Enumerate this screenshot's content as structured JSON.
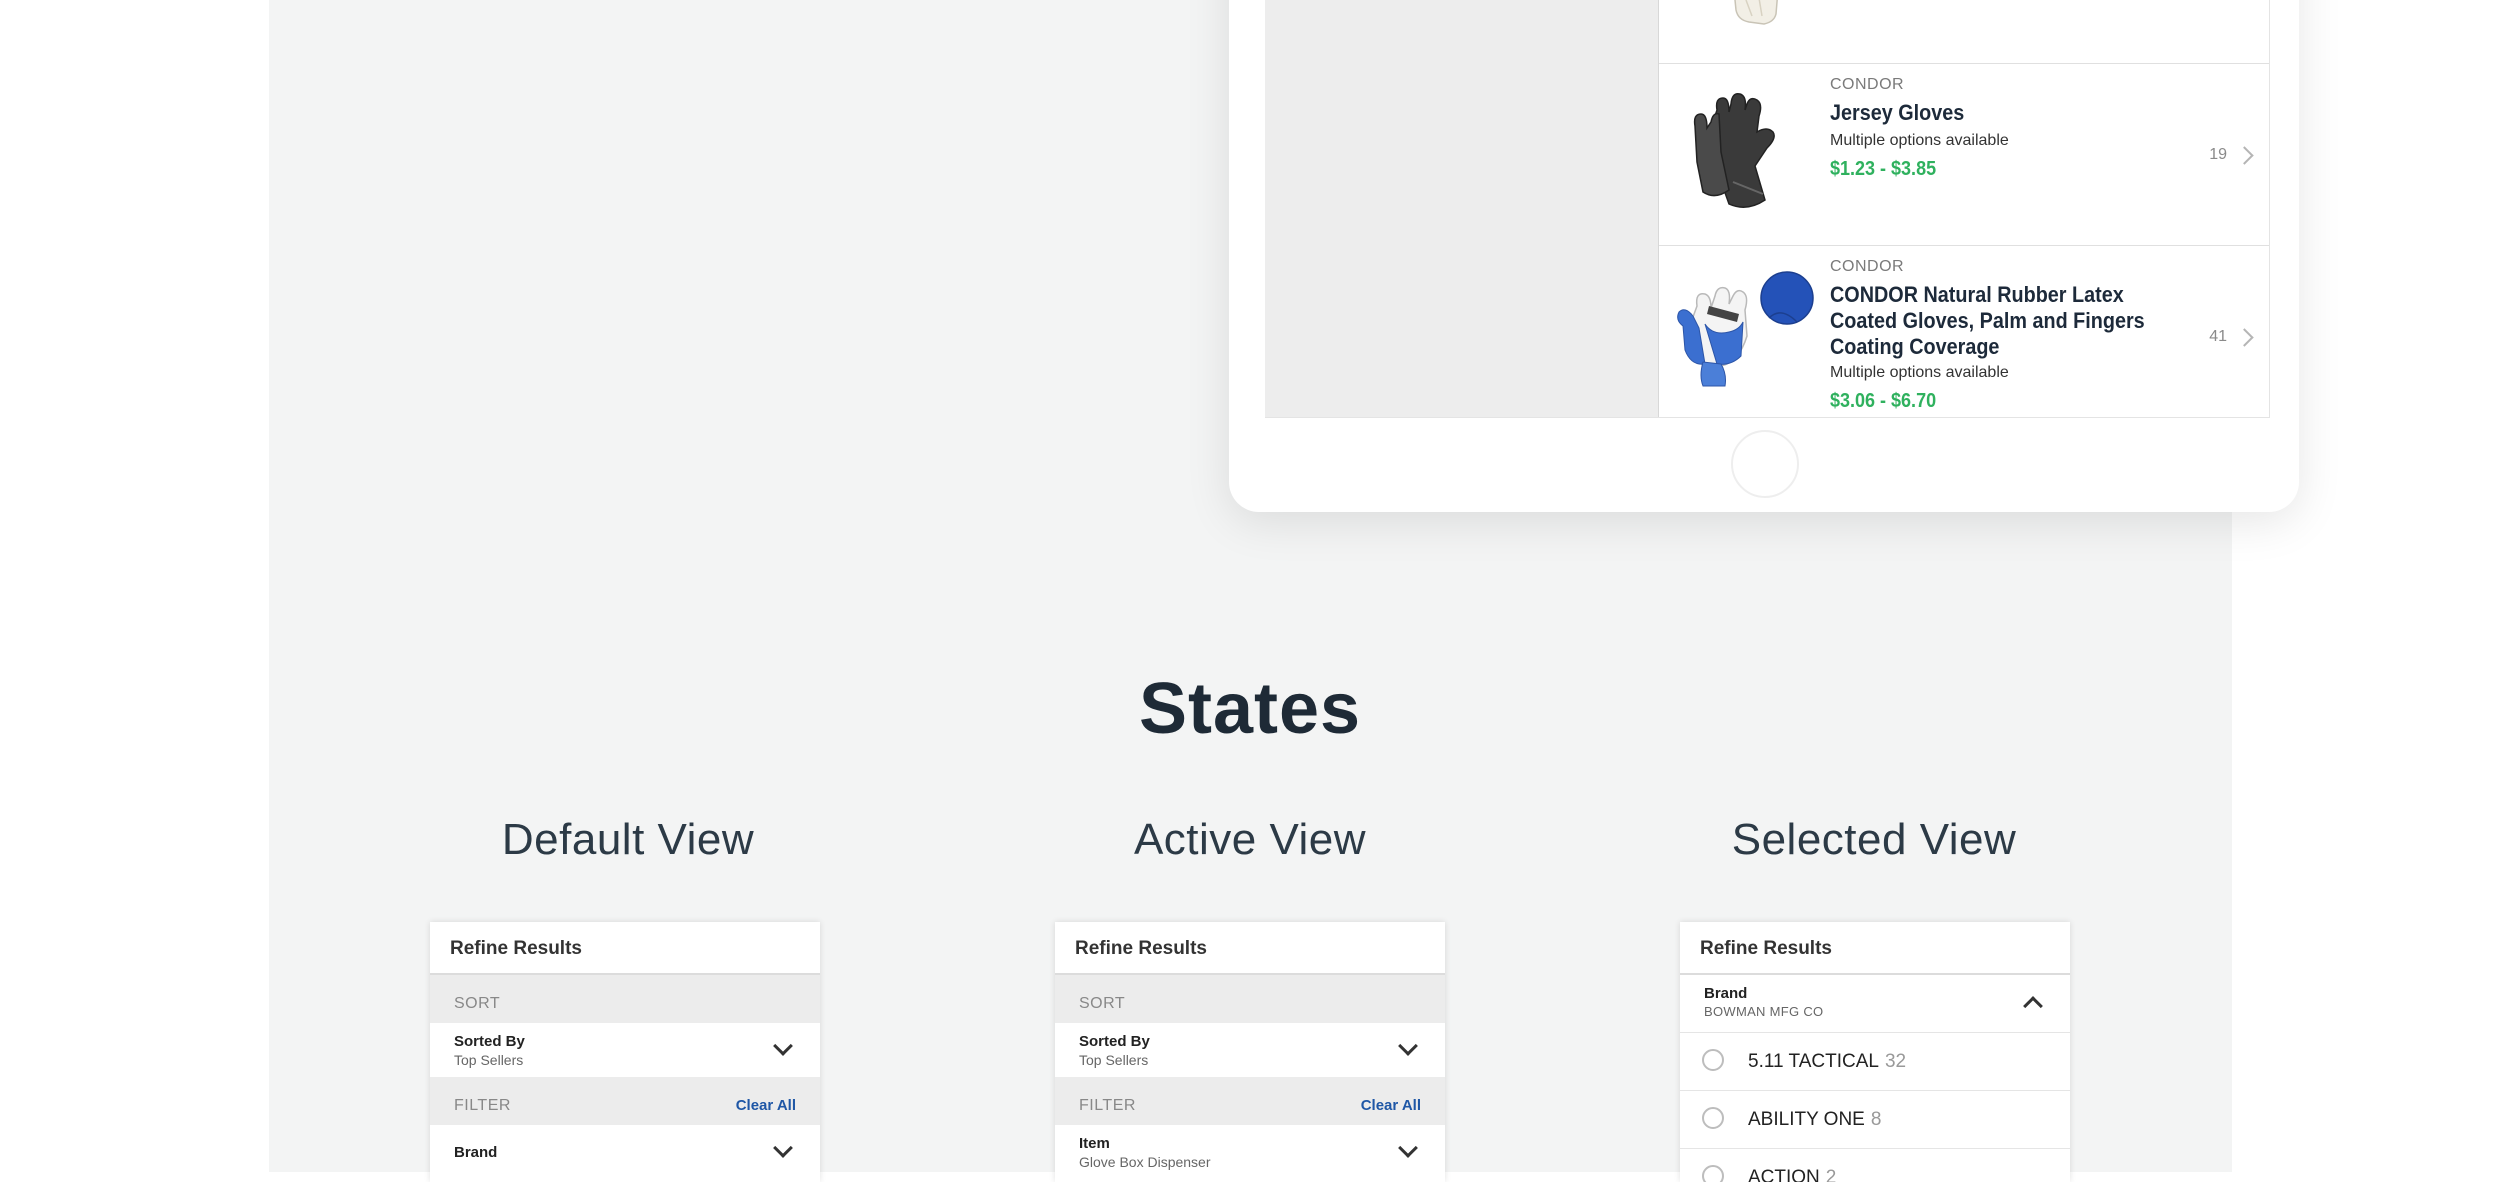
{
  "products": [
    {
      "brand": "",
      "name": "",
      "options": "",
      "price": "",
      "count": ""
    },
    {
      "brand": "CONDOR",
      "name": "Jersey Gloves",
      "options": "Multiple options available",
      "price": "$1.23 - $3.85",
      "count": "19"
    },
    {
      "brand": "CONDOR",
      "name": "CONDOR Natural Rubber Latex Coated Gloves, Palm and Fingers Coating Coverage",
      "options": "Multiple options available",
      "price": "$3.06 - $6.70",
      "count": "41"
    }
  ],
  "states_title": "States",
  "views": [
    {
      "title": "Default View",
      "card_title": "Refine Results",
      "sort_label": "SORT",
      "sort_field": "Sorted By",
      "sort_value": "Top Sellers",
      "filter_label": "FILTER",
      "clear_all": "Clear All",
      "filter_field": "Brand",
      "filter_value": ""
    },
    {
      "title": "Active View",
      "card_title": "Refine Results",
      "sort_label": "SORT",
      "sort_field": "Sorted By",
      "sort_value": "Top Sellers",
      "filter_label": "FILTER",
      "clear_all": "Clear All",
      "filter_field": "Item",
      "filter_value": "Glove Box Dispenser"
    },
    {
      "title": "Selected View",
      "card_title": "Refine Results",
      "field": "Brand",
      "field_value": "BOWMAN MFG CO",
      "options": [
        {
          "name": "5.11 TACTICAL",
          "count": "32"
        },
        {
          "name": "ABILITY ONE",
          "count": "8"
        },
        {
          "name": "ACTION",
          "count": "2"
        }
      ]
    }
  ],
  "colors": {
    "price": "#2fb15e",
    "link": "#1f57a6",
    "panel": "#f3f4f4",
    "title": "#1e2a36"
  },
  "icons": [
    "chevron-right-icon",
    "chevron-down-icon",
    "chevron-up-icon",
    "radio-icon",
    "glove-image"
  ]
}
